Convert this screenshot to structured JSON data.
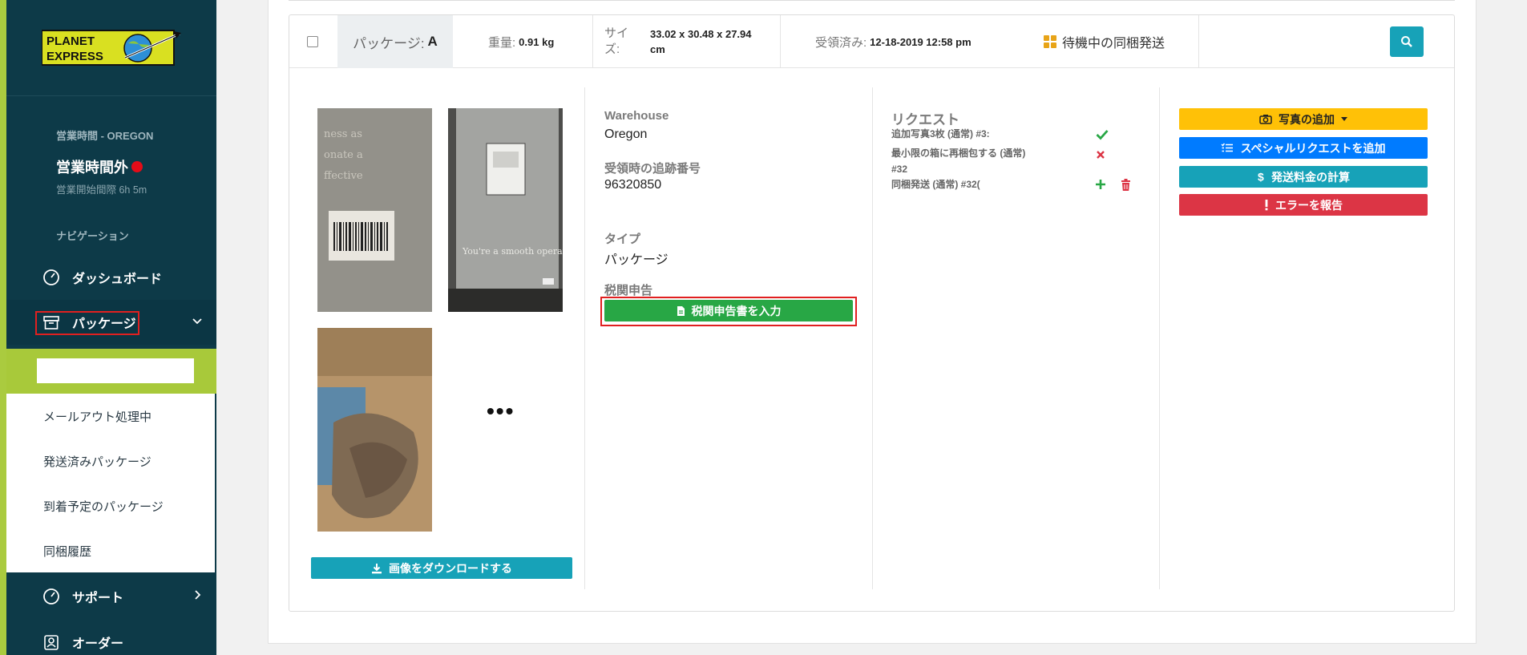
{
  "sidebar": {
    "logo_line1": "PLANET",
    "logo_line2": "EXPRESS",
    "hours_label": "営業時間 - OREGON",
    "hours_status": "営業時間外",
    "hours_sub": "営業開始間際 6h 5m",
    "nav_label": "ナビゲーション",
    "items": [
      {
        "label": "ダッシュボード",
        "icon": "dashboard-icon"
      },
      {
        "label": "パッケージ",
        "icon": "package-icon"
      },
      {
        "label": "サポート",
        "icon": "support-icon"
      },
      {
        "label": "オーダー",
        "icon": "order-icon"
      }
    ],
    "subitems": [
      {
        "label": "メールアウト処理中"
      },
      {
        "label": "発送済みパッケージ"
      },
      {
        "label": "到着予定のパッケージ"
      },
      {
        "label": "同梱履歴"
      }
    ]
  },
  "package": {
    "name_label": "パッケージ:",
    "name_value": "A",
    "weight_label": "重量:",
    "weight_value": "0.91 kg",
    "size_label": "サイズ:",
    "size_value": "33.02 x 30.48 x 27.94 cm",
    "received_label": "受領済み:",
    "received_value": "12-18-2019 12:58 pm",
    "status": "待機中の同梱発送",
    "download_button": "画像をダウンロードする",
    "more": "•••"
  },
  "info": {
    "warehouse_label": "Warehouse",
    "warehouse_value": "Oregon",
    "tracking_label": "受領時の追跡番号",
    "tracking_value": "96320850",
    "type_label": "タイプ",
    "type_value": "パッケージ",
    "customs_label": "税関申告",
    "customs_button": "税関申告書を入力"
  },
  "requests": {
    "title": "リクエスト",
    "items": [
      {
        "text": "追加写真3枚 (通常) #3:",
        "status": "check"
      },
      {
        "text": "最小限の箱に再梱包する (通常) #32",
        "status": "cross"
      },
      {
        "text": "同梱発送 (通常) #32(",
        "status": "pending"
      }
    ]
  },
  "actions": {
    "add_photo": "写真の追加",
    "special_request": "スペシャルリクエストを追加",
    "calc_shipping": "発送料金の計算",
    "report_error": "エラーを報告"
  },
  "colors": {
    "sidebar": "#0d3a48",
    "lime": "#a8c93a",
    "teal": "#17a2b8",
    "green": "#28a745",
    "blue": "#007bff",
    "yellow": "#ffc107",
    "red": "#dc3545"
  }
}
